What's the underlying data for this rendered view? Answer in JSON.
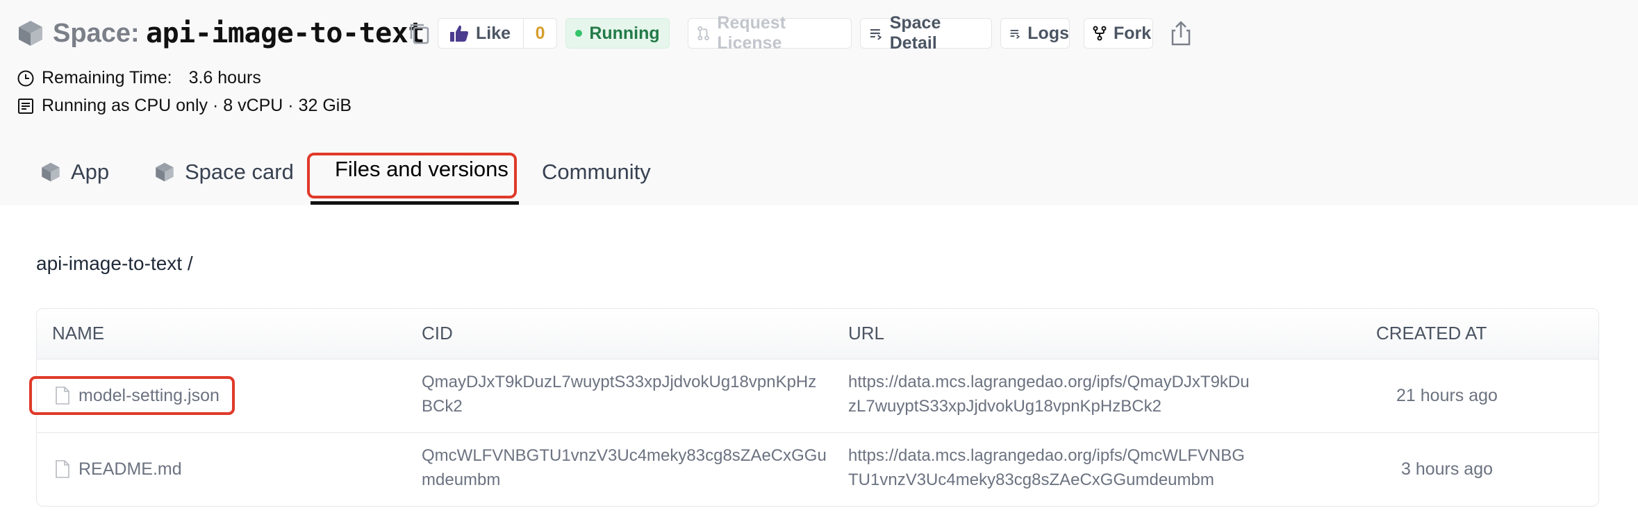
{
  "header": {
    "space_prefix": "Space:",
    "space_name": "api-image-to-text",
    "like_label": "Like",
    "like_count": "0",
    "status": "Running",
    "request_license": "Request License",
    "space_detail": "Space Detail",
    "logs": "Logs",
    "fork": "Fork"
  },
  "meta": {
    "remaining_label": "Remaining Time:",
    "remaining_value": "3.6 hours",
    "runtime": "Running as CPU only · 8 vCPU · 32 GiB"
  },
  "tabs": [
    {
      "label": "App"
    },
    {
      "label": "Space card"
    },
    {
      "label": "Files and versions"
    },
    {
      "label": "Community"
    }
  ],
  "breadcrumb": "api-image-to-text /",
  "table": {
    "columns": [
      "NAME",
      "CID",
      "URL",
      "CREATED AT"
    ],
    "rows": [
      {
        "name": "model-setting.json",
        "cid": "QmayDJxT9kDuzL7wuyptS33xpJjdvokUg18vpnKpHzBCk2",
        "url": "https://data.mcs.lagrangedao.org/ipfs/QmayDJxT9kDuzL7wuyptS33xpJjdvokUg18vpnKpHzBCk2",
        "created": "21 hours ago"
      },
      {
        "name": "README.md",
        "cid": "QmcWLFVNBGTU1vnzV3Uc4meky83cg8sZAeCxGGumdeumbm",
        "url": "https://data.mcs.lagrangedao.org/ipfs/QmcWLFVNBGTU1vnzV3Uc4meky83cg8sZAeCxGGumdeumbm",
        "created": "3 hours ago"
      }
    ]
  },
  "colors": {
    "highlight": "#e03a2a",
    "running_bg": "#e7f6ec",
    "running_text": "#237a48",
    "like_count": "#d69e2e"
  },
  "icons": [
    "cube-icon",
    "copy-icon",
    "thumbs-up-icon",
    "status-dot-icon",
    "pull-request-icon",
    "list-icon",
    "fork-icon",
    "share-icon",
    "clock-icon",
    "document-icon",
    "file-icon"
  ]
}
